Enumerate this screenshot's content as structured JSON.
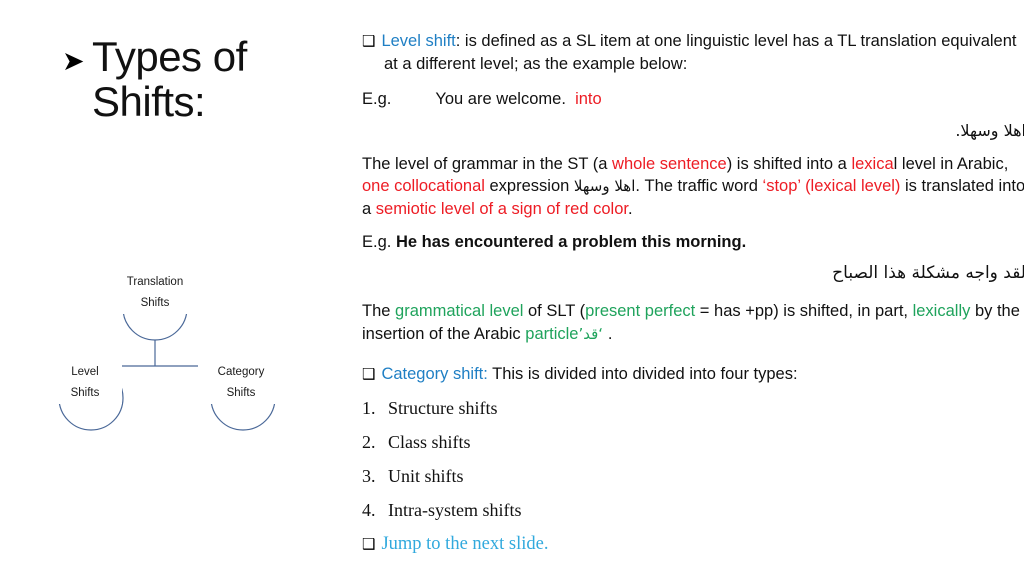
{
  "slide": {
    "title_line1": "Types of",
    "title_line2": "Shifts:",
    "arrow_bullet": "➤",
    "square_bullet": "❑"
  },
  "diagram": {
    "root_line1": "Translation",
    "root_line2": "Shifts",
    "left_line1": "Level",
    "left_line2": "Shifts",
    "right_line1": "Category",
    "right_line2": "Shifts",
    "stroke_color": "#4A6898"
  },
  "colors": {
    "blue": "#1F7FC4",
    "light_blue": "#31A9DD",
    "red": "#ED1C24",
    "green": "#1FA35C"
  },
  "body": {
    "level_shift_term": "Level shift",
    "level_shift_def": ": is defined as  a SL item at one linguistic level has a TL translation equivalent at a different level; as the example below:",
    "eg1_label": "E.g.",
    "eg1_source": "You are welcome.",
    "eg1_into": "into",
    "eg1_arabic": "اهلا وسهلا.",
    "p1_a": "The level of grammar in the ST (a ",
    "p1_whole_sentence": "whole sentence",
    "p1_b": ") is shifted into a ",
    "p1_lexica": "lexica",
    "p1_l": "l",
    "p1_c": " level in Arabic, ",
    "p1_one_colloc": "one collocational",
    "p1_d": " expression ",
    "p1_arabic_inline": "اهلا وسهلا",
    "p1_e": ". The traffic word ",
    "p1_stop": "‘stop’",
    "p1_lexical_level": "(lexical level)",
    "p1_f": " is translated into a ",
    "p1_semiotic": "semiotic level of a sign of red color",
    "p1_g": ".",
    "eg2_label": "E.g.",
    "eg2_source": "He has encountered a problem this morning.",
    "eg2_arabic": "لقد واجه مشكلة هذا الصباح",
    "p2_a": "The ",
    "p2_gram_level": "grammatical level",
    "p2_b": " of SLT (",
    "p2_pres_perf": "present perfect",
    "p2_c": " = has +pp) is shifted, in part, ",
    "p2_lexically": "lexically",
    "p2_d": " by the insertion of the Arabic ",
    "p2_particle": "particle",
    "p2_qad": " ‘قد’",
    "p2_e": ".",
    "category_shift_term": "Category shift:",
    "category_shift_def": " This is divided into divided into four types:",
    "types": [
      {
        "num": "1.",
        "label": "Structure shifts"
      },
      {
        "num": "2.",
        "label": "Class shifts"
      },
      {
        "num": "3.",
        "label": "Unit shifts"
      },
      {
        "num": "4.",
        "label": "Intra-system shifts"
      }
    ],
    "jump_link": "Jump to the next slide",
    "jump_period": "."
  }
}
